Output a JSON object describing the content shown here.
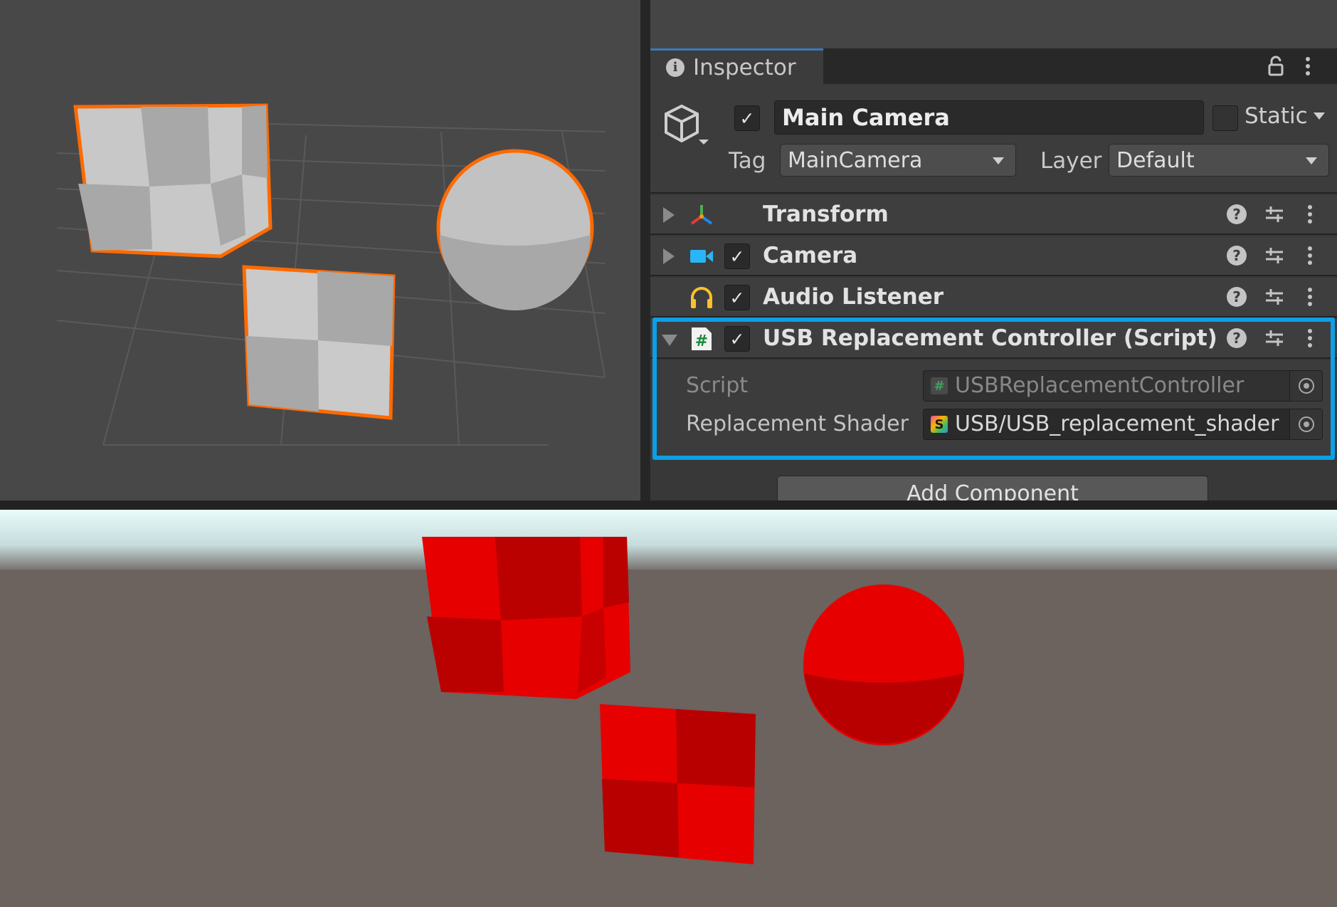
{
  "inspector": {
    "tab_label": "Inspector",
    "gameobject": {
      "name": "Main Camera",
      "static_label": "Static",
      "tag_label": "Tag",
      "tag_value": "MainCamera",
      "layer_label": "Layer",
      "layer_value": "Default"
    },
    "components": [
      {
        "name": "Transform",
        "icon": "transform-icon",
        "expanded": false,
        "has_toggle": false
      },
      {
        "name": "Camera",
        "icon": "camera-icon",
        "expanded": false,
        "has_toggle": true
      },
      {
        "name": "Audio Listener",
        "icon": "headphones-icon",
        "expanded": false,
        "has_toggle": true
      },
      {
        "name": "USB Replacement Controller (Script)",
        "icon": "csharp-script-icon",
        "expanded": true,
        "has_toggle": true
      }
    ],
    "script_component": {
      "script_label": "Script",
      "script_value": "USBReplacementController",
      "replacement_shader_label": "Replacement Shader",
      "replacement_shader_value": "USB/USB_replacement_shader"
    },
    "add_component_label": "Add Component"
  },
  "colors": {
    "selection_outline": "#ff6a00",
    "highlight_box": "#0c9fe8",
    "replacement_red": "#e60000",
    "replacement_dark_red": "#b80000",
    "scene_background": "#484848",
    "game_ground": "#6c625e"
  }
}
